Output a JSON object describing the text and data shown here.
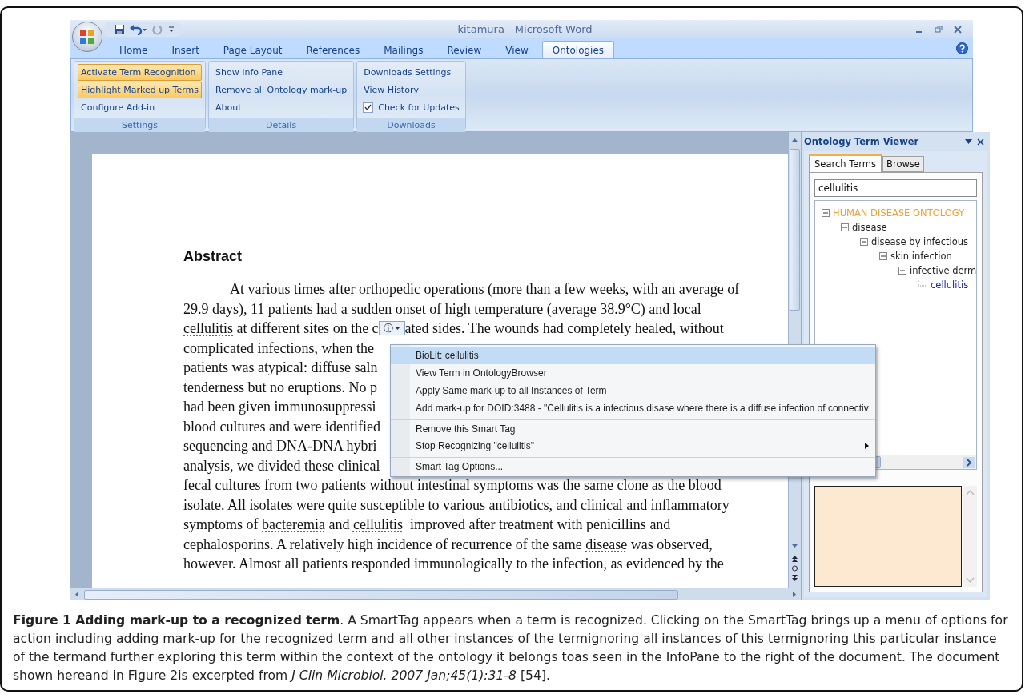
{
  "window": {
    "title": "kitamura - Microsoft Word"
  },
  "tabs": [
    {
      "label": "Home",
      "selected": false
    },
    {
      "label": "Insert",
      "selected": false
    },
    {
      "label": "Page Layout",
      "selected": false
    },
    {
      "label": "References",
      "selected": false
    },
    {
      "label": "Mailings",
      "selected": false
    },
    {
      "label": "Review",
      "selected": false
    },
    {
      "label": "View",
      "selected": false
    },
    {
      "label": "Ontologies",
      "selected": true
    }
  ],
  "ribbon_groups": [
    {
      "label": "Settings",
      "items": [
        {
          "kind": "button",
          "label": "Activate Term Recognition",
          "active": true
        },
        {
          "kind": "button",
          "label": "Highlight Marked up Terms",
          "active": true
        },
        {
          "kind": "button",
          "label": "Configure Add-in",
          "active": false
        }
      ]
    },
    {
      "label": "Details",
      "items": [
        {
          "kind": "button",
          "label": "Show Info Pane",
          "active": false
        },
        {
          "kind": "button",
          "label": "Remove all Ontology mark-up",
          "active": false
        },
        {
          "kind": "button",
          "label": "About",
          "active": false
        }
      ]
    },
    {
      "label": "Downloads",
      "items": [
        {
          "kind": "button",
          "label": "Downloads Settings",
          "active": false
        },
        {
          "kind": "button",
          "label": "View History",
          "active": false
        },
        {
          "kind": "checkbox",
          "label": "Check for Updates",
          "checked": true
        }
      ]
    }
  ],
  "document": {
    "heading": "Abstract",
    "lines": [
      {
        "indent": true,
        "segments": [
          {
            "kind": "text",
            "text": "At various times after orthopedic operations (more than a few weeks, with an average of"
          }
        ]
      },
      {
        "indent": false,
        "segments": [
          {
            "kind": "text",
            "text": "29.9 days), 11 patients had a sudden onset of high temperature (average 38.9°C) and local"
          }
        ]
      },
      {
        "indent": false,
        "segments": [
          {
            "kind": "marked",
            "text": "cellulitis"
          },
          {
            "kind": "text",
            "text": " at different sites on the c"
          },
          {
            "kind": "smart-tag",
            "text": "ⓘ"
          },
          {
            "kind": "text",
            "text": "ated sides. The wounds had completely healed, without"
          }
        ]
      },
      {
        "indent": false,
        "segments": [
          {
            "kind": "text",
            "text": "complicated infections, when the"
          }
        ]
      },
      {
        "indent": false,
        "segments": [
          {
            "kind": "text",
            "text": "patients was atypical: diffuse saln"
          }
        ]
      },
      {
        "indent": false,
        "segments": [
          {
            "kind": "text",
            "text": "tenderness but no eruptions. No p"
          }
        ]
      },
      {
        "indent": false,
        "segments": [
          {
            "kind": "text",
            "text": "had been given immunosuppressi"
          }
        ]
      },
      {
        "indent": false,
        "segments": [
          {
            "kind": "text",
            "text": "blood cultures and were identified"
          }
        ]
      },
      {
        "indent": false,
        "segments": [
          {
            "kind": "text",
            "text": "sequencing and DNA-DNA hybri"
          }
        ]
      },
      {
        "indent": false,
        "segments": [
          {
            "kind": "text",
            "text": "analysis, we divided these clinical"
          }
        ]
      },
      {
        "indent": false,
        "segments": [
          {
            "kind": "text",
            "text": "fecal cultures from two patients without intestinal symptoms was the same clone as the blood"
          }
        ]
      },
      {
        "indent": false,
        "segments": [
          {
            "kind": "text",
            "text": "isolate. All isolates were quite susceptible to various antibiotics, and clinical and inflammatory"
          }
        ]
      },
      {
        "indent": false,
        "segments": [
          {
            "kind": "text",
            "text": "symptoms of "
          },
          {
            "kind": "marked",
            "text": "bacteremia"
          },
          {
            "kind": "text",
            "text": " and "
          },
          {
            "kind": "marked",
            "text": "cellulitis"
          },
          {
            "kind": "text",
            "text": "  improved after treatment with penicillins and"
          }
        ]
      },
      {
        "indent": false,
        "segments": [
          {
            "kind": "text",
            "text": "cephalosporins. A relatively high incidence of recurrence of the same "
          },
          {
            "kind": "marked",
            "text": "disease"
          },
          {
            "kind": "text",
            "text": " was observed,"
          }
        ]
      },
      {
        "indent": false,
        "segments": [
          {
            "kind": "text",
            "text": "however. Almost all patients responded immunologically to the infection, as evidenced by the"
          }
        ]
      }
    ]
  },
  "context_menu": {
    "items": [
      {
        "label": "BioLit: cellulitis",
        "selected": true,
        "submenu": false,
        "separator_before": false
      },
      {
        "label": "View Term in OntologyBrowser",
        "selected": false,
        "submenu": false,
        "separator_before": false
      },
      {
        "label": "Apply Same mark-up to all Instances of Term",
        "selected": false,
        "submenu": false,
        "separator_before": false
      },
      {
        "label": "Add mark-up for DOID:3488 - \"Cellulitis is a infectious disase where there is a diffuse infection of connectiv",
        "selected": false,
        "submenu": false,
        "separator_before": false
      },
      {
        "label": "Remove this Smart Tag",
        "selected": false,
        "submenu": false,
        "separator_before": true
      },
      {
        "label": "Stop Recognizing \"cellulitis\"",
        "selected": false,
        "submenu": true,
        "separator_before": false
      },
      {
        "label": "Smart Tag Options...",
        "selected": false,
        "submenu": false,
        "separator_before": true
      }
    ]
  },
  "task_pane": {
    "title": "Ontology Term Viewer",
    "tabs": [
      {
        "label": "Search Terms",
        "selected": true
      },
      {
        "label": "Browse",
        "selected": false
      }
    ],
    "search": {
      "value": "cellulitis"
    },
    "tree": [
      {
        "label": "HUMAN DISEASE ONTOLOGY",
        "color": "#e8a23a",
        "expanded": true,
        "children": [
          {
            "label": "disease",
            "color": "#222222",
            "expanded": true,
            "children": [
              {
                "label": "disease by infectious",
                "color": "#222222",
                "expanded": true,
                "children": [
                  {
                    "label": "skin infection",
                    "color": "#222222",
                    "expanded": true,
                    "children": [
                      {
                        "label": "infective derm",
                        "color": "#222222",
                        "expanded": true,
                        "children": [
                          {
                            "label": "cellulitis",
                            "color": "#2222aa"
                          }
                        ]
                      }
                    ]
                  }
                ]
              }
            ]
          }
        ]
      }
    ]
  },
  "caption": "**Figure 1 Adding mark-up to a recognized term**. A SmartTag appears when a term is recognized. Clicking on the SmartTag brings up a menu of options for action including adding mark-up for the recognized term and all other instances of the termignoring all instances of this termignoring this particular instance of the termand further exploring this term within the context of the ontology it belongs toas seen in the InfoPane to the right of the document. The document shown hereand in Figure 2is excerpted from *J Clin Microbiol. 2007 Jan;45(1):31-8* [54]."
}
